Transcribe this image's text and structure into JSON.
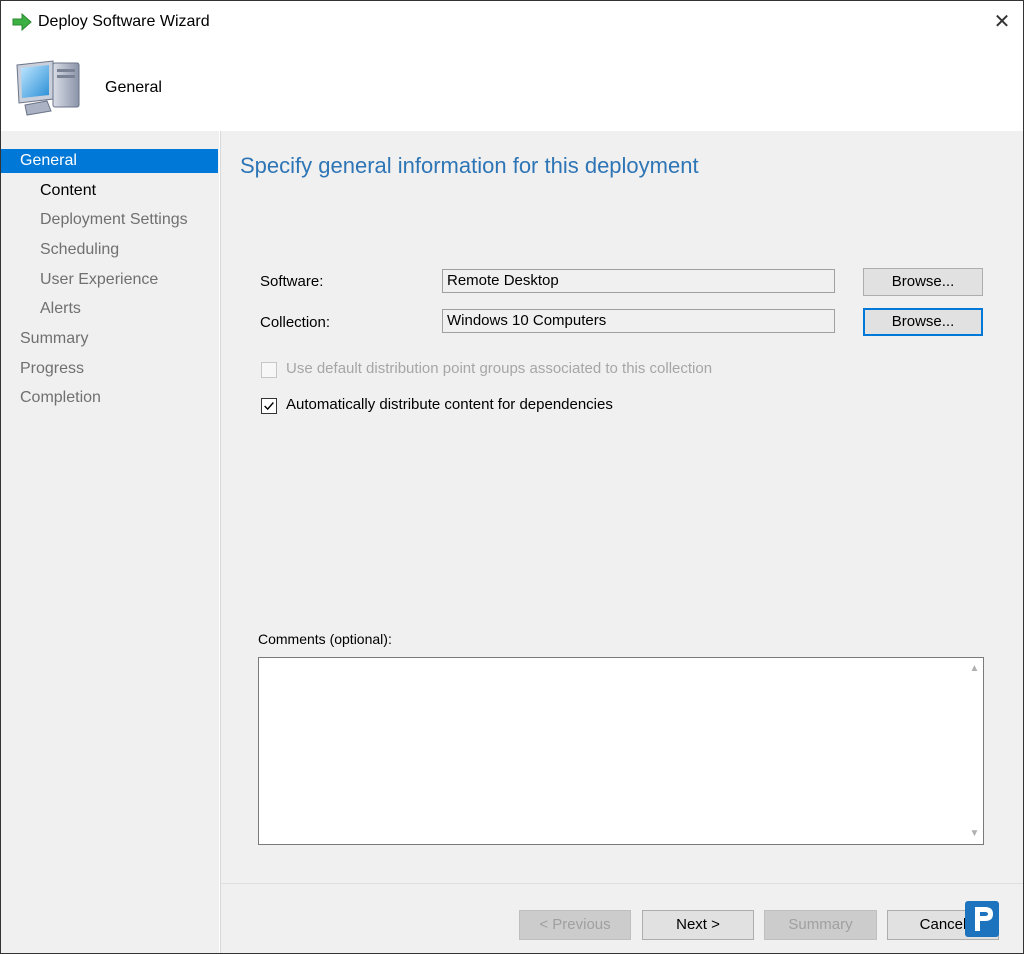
{
  "window": {
    "title": "Deploy Software Wizard",
    "close_symbol": "✕"
  },
  "header": {
    "title": "General",
    "icon": "computer-icon"
  },
  "nav": {
    "items": [
      {
        "label": "General",
        "state": "selected"
      },
      {
        "label": "Content",
        "state": "current"
      },
      {
        "label": "Deployment Settings",
        "state": "normal"
      },
      {
        "label": "Scheduling",
        "state": "normal"
      },
      {
        "label": "User Experience",
        "state": "normal"
      },
      {
        "label": "Alerts",
        "state": "normal"
      },
      {
        "label": "Summary",
        "state": "normal"
      },
      {
        "label": "Progress",
        "state": "normal"
      },
      {
        "label": "Completion",
        "state": "normal"
      }
    ]
  },
  "main": {
    "heading": "Specify general information for this deployment",
    "software": {
      "label": "Software:",
      "value": "Remote Desktop",
      "browse_label": "Browse..."
    },
    "collection": {
      "label": "Collection:",
      "value": "Windows 10 Computers",
      "browse_label": "Browse..."
    },
    "default_dp_groups": {
      "label": "Use default distribution point groups associated to this collection",
      "checked": false,
      "enabled": false
    },
    "auto_distribute": {
      "label": "Automatically distribute content for dependencies",
      "checked": true,
      "enabled": true
    },
    "comments": {
      "label": "Comments (optional):",
      "value": ""
    }
  },
  "footer": {
    "previous_label": "< Previous",
    "next_label": "Next >",
    "summary_label": "Summary",
    "cancel_label": "Cancel"
  },
  "colors": {
    "accent": "#0078d7",
    "heading": "#2e75b6"
  }
}
